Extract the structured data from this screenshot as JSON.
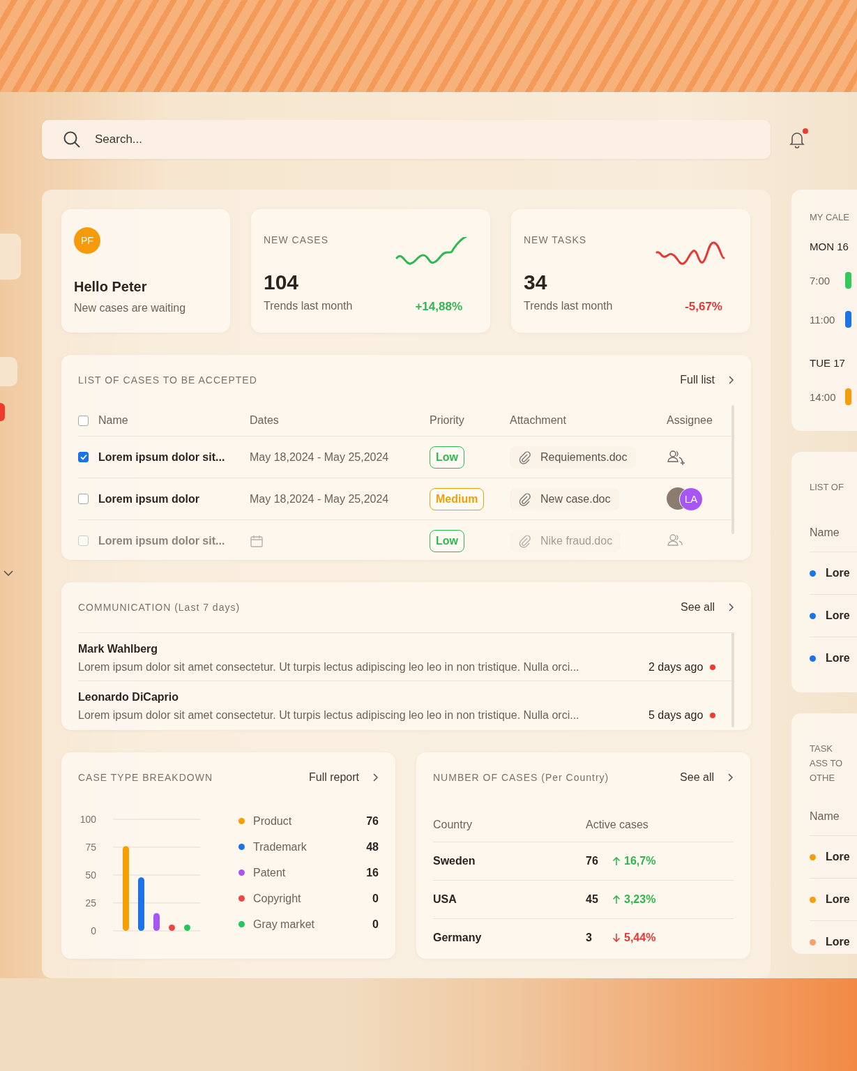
{
  "sidebar": {
    "items": [
      {
        "kind": "tab"
      },
      {
        "kind": "tab"
      },
      {
        "kind": "marker"
      }
    ]
  },
  "search": {
    "placeholder": "Search..."
  },
  "notifications": {
    "unread": true
  },
  "greeting": {
    "avatar": "PF",
    "title": "Hello Peter",
    "subtitle": "New cases are waiting"
  },
  "stats": [
    {
      "label": "NEW CASES",
      "value": "104",
      "caption": "Trends last month",
      "change": "+14,88%",
      "kind": "up"
    },
    {
      "label": "NEW TASKS",
      "value": "34",
      "caption": "Trends last month",
      "change": "-5,67%",
      "kind": "down"
    }
  ],
  "cases": {
    "title": "LIST OF CASES TO BE ACCEPTED",
    "link": "Full list",
    "all_checked": false,
    "columns": [
      "Name",
      "Dates",
      "Priority",
      "Attachment",
      "Assignee"
    ],
    "rows": [
      {
        "checked": true,
        "name": "Lorem ipsum dolor sit...",
        "dates": "May 18,2024 - May 25,2024",
        "priority": "Low",
        "color": "#2fb84f",
        "attachment": "Requiements.doc",
        "kind": "add"
      },
      {
        "checked": false,
        "name": "Lorem ipsum dolor",
        "dates": "May 18,2024 - May 25,2024",
        "priority": "Medium",
        "color": "#e9a20a",
        "attachment": "New case.doc",
        "kind": "avatars",
        "initials": "LA"
      },
      {
        "checked": false,
        "name": "Lorem ipsum dolor sit...",
        "dates_icon": true,
        "priority": "Low",
        "color": "#2fb84f",
        "attachment": "Nike fraud.doc",
        "kind": "group"
      }
    ]
  },
  "communication": {
    "title": "COMMUNICATION (Last 7 days)",
    "link": "See all",
    "messages": [
      {
        "sender": "Mark Wahlberg",
        "text": "Lorem ipsum dolor sit amet consectetur. Ut turpis lectus adipiscing leo leo in non tristique. Nulla orci...",
        "time": "2 days ago",
        "unread": true
      },
      {
        "sender": "Leonardo DiCaprio",
        "text": "Lorem ipsum dolor sit amet consectetur. Ut turpis lectus adipiscing leo leo in non tristique. Nulla orci...",
        "time": "5 days ago",
        "unread": true
      }
    ]
  },
  "breakdown": {
    "title": "CASE TYPE BREAKDOWN",
    "link": "Full report",
    "chart_data": {
      "type": "bar",
      "values": [
        76,
        48,
        16,
        0,
        0
      ],
      "ylim": [
        0,
        100
      ],
      "yticks": [
        0,
        25,
        50,
        75,
        100
      ],
      "grid": true
    },
    "legend": [
      {
        "label": "Product",
        "value": "76",
        "color": "#f5a000"
      },
      {
        "label": "Trademark",
        "value": "48",
        "color": "#1a73e8"
      },
      {
        "label": "Patent",
        "value": "16",
        "color": "#a855f7"
      },
      {
        "label": "Copyright",
        "value": "0",
        "color": "#ef4444"
      },
      {
        "label": "Gray market",
        "value": "0",
        "color": "#22c55e"
      }
    ]
  },
  "countries": {
    "title": "NUMBER OF CASES (Per Country)",
    "link": "See all",
    "columns": [
      "Country",
      "Active cases"
    ],
    "rows": [
      {
        "country": "Sweden",
        "cases": "76",
        "change": "16,7%",
        "kind": "up"
      },
      {
        "country": "USA",
        "cases": "45",
        "change": "3,23%",
        "kind": "up"
      },
      {
        "country": "Germany",
        "cases": "3",
        "change": "5,44%",
        "kind": "down"
      }
    ]
  },
  "calendar": {
    "title": "MY CALE",
    "days": [
      {
        "day": "MON 16",
        "events": [
          {
            "time": "7:00",
            "color": "#34c759"
          },
          {
            "time": "11:00",
            "color": "#1a73e8"
          }
        ]
      },
      {
        "day": "TUE 17",
        "events": [
          {
            "time": "14:00",
            "color": "#f59e0b"
          }
        ]
      }
    ]
  },
  "side_lists": [
    {
      "title": "LIST OF",
      "column": "Name",
      "items": [
        {
          "name": "Lore",
          "color": "#1a73e8"
        },
        {
          "name": "Lore",
          "color": "#1a73e8"
        },
        {
          "name": "Lore",
          "color": "#1a73e8"
        }
      ]
    },
    {
      "title": "TASK ASS TO OTHE",
      "column": "Name",
      "items": [
        {
          "name": "Lore",
          "color": "#f59e0b"
        },
        {
          "name": "Lore",
          "color": "#f59e0b"
        },
        {
          "name": "Lore",
          "color": "#f4a06a"
        }
      ]
    }
  ]
}
